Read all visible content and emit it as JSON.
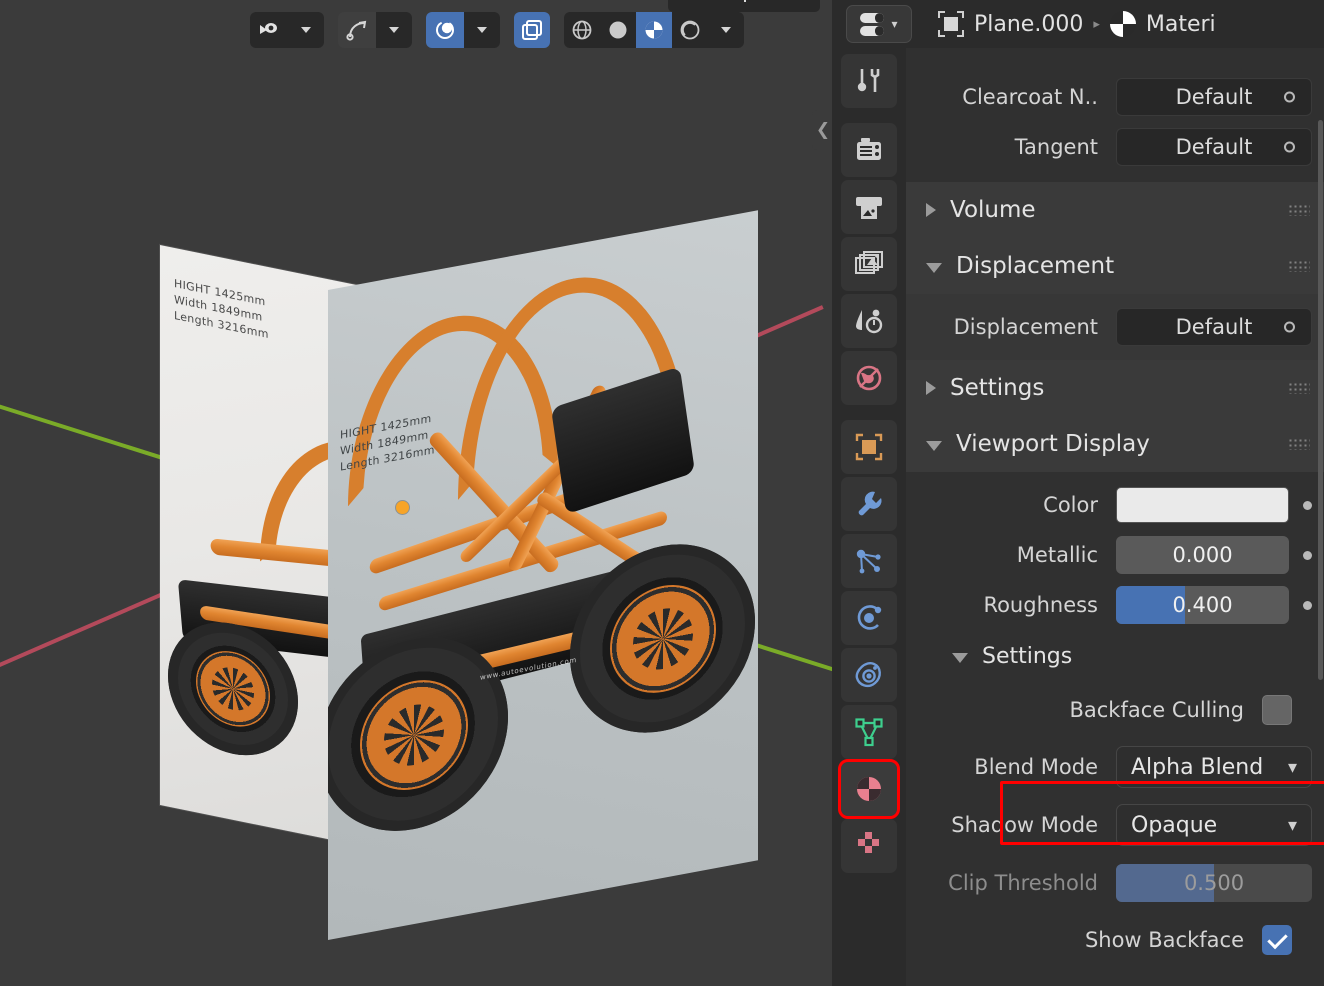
{
  "app": "Blender",
  "viewport": {
    "toolbar": {
      "groups": [
        {
          "name": "visibility",
          "buttons": [
            {
              "icon": "eye-dropdown-icon",
              "label": "",
              "state": "normal"
            },
            {
              "icon": "chevron-down-icon",
              "label": "",
              "state": "normal"
            }
          ]
        },
        {
          "name": "snap",
          "buttons": [
            {
              "icon": "snap-magnet-icon",
              "label": "",
              "state": "raised"
            },
            {
              "icon": "chevron-down-icon",
              "label": "",
              "state": "normal"
            }
          ]
        },
        {
          "name": "proportional-edit",
          "buttons": [
            {
              "icon": "proportional-edit-icon",
              "label": "",
              "state": "active"
            },
            {
              "icon": "chevron-down-icon",
              "label": "",
              "state": "normal"
            }
          ]
        },
        {
          "name": "overlays",
          "buttons": [
            {
              "icon": "overlay-icon",
              "label": "",
              "state": "active"
            }
          ]
        },
        {
          "name": "shading",
          "buttons": [
            {
              "icon": "wireframe-shading-icon",
              "label": "",
              "state": "normal"
            },
            {
              "icon": "solid-shading-icon",
              "label": "",
              "state": "normal"
            },
            {
              "icon": "material-preview-shading-icon",
              "label": "",
              "state": "active"
            },
            {
              "icon": "rendered-shading-icon",
              "label": "",
              "state": "normal"
            },
            {
              "icon": "chevron-down-icon",
              "label": "",
              "state": "normal"
            }
          ]
        }
      ]
    },
    "sidebar_toggle_icon": "chevron-left-icon",
    "reference_planes": [
      {
        "name": "back-plane",
        "dimension_lines": [
          "HIGHT 1425mm",
          "Width 1849mm",
          "Length 3216mm"
        ]
      },
      {
        "name": "front-plane",
        "dimension_lines": [
          "HIGHT 1425mm",
          "Width 1849mm",
          "Length 3216mm"
        ]
      }
    ],
    "image_watermark": "www.autoevolution.com",
    "origin_marker": "object-origin-dot",
    "axis_colors": {
      "x": "#b34a5b",
      "y": "#7aab28"
    }
  },
  "properties": {
    "header": {
      "editor_type_icon": "properties-editor-icon",
      "editor_type_chevron": "chevron-down-icon",
      "breadcrumb": [
        {
          "icon": "object-data-icon",
          "label": "Plane.000"
        },
        {
          "icon": "material-icon",
          "label": "Materi"
        }
      ],
      "separator": "▸"
    },
    "tabs": [
      {
        "name": "tool",
        "icon": "tool-icon",
        "selected": false,
        "highlighted": false
      },
      {
        "name": "render",
        "icon": "render-camera-icon",
        "selected": false,
        "highlighted": false
      },
      {
        "name": "output",
        "icon": "output-printer-icon",
        "selected": false,
        "highlighted": false
      },
      {
        "name": "view-layer",
        "icon": "view-layer-images-icon",
        "selected": false,
        "highlighted": false
      },
      {
        "name": "scene",
        "icon": "scene-cone-droplet-icon",
        "selected": false,
        "highlighted": false
      },
      {
        "name": "world",
        "icon": "world-globe-icon",
        "selected": false,
        "highlighted": false
      },
      {
        "name": "object",
        "icon": "object-square-icon",
        "selected": false,
        "highlighted": false
      },
      {
        "name": "modifiers",
        "icon": "wrench-icon",
        "selected": false,
        "highlighted": false
      },
      {
        "name": "particles",
        "icon": "particles-icon",
        "selected": false,
        "highlighted": false
      },
      {
        "name": "physics",
        "icon": "physics-orbit-icon",
        "selected": false,
        "highlighted": false
      },
      {
        "name": "constraints",
        "icon": "constraints-icon",
        "selected": false,
        "highlighted": false
      },
      {
        "name": "object-data",
        "icon": "mesh-data-triangle-icon",
        "selected": false,
        "highlighted": false
      },
      {
        "name": "material",
        "icon": "material-sphere-icon",
        "selected": true,
        "highlighted": true
      },
      {
        "name": "texture",
        "icon": "texture-checker-icon",
        "selected": false,
        "highlighted": false
      }
    ],
    "rows": {
      "clearcoat_normal": {
        "label": "Clearcoat N..",
        "value": "Default",
        "socket": "input-socket-icon"
      },
      "tangent": {
        "label": "Tangent",
        "value": "Default",
        "socket": "input-socket-icon"
      }
    },
    "panels": {
      "volume": {
        "label": "Volume",
        "open": false,
        "grip": "drag-grip-icon"
      },
      "displacement": {
        "label": "Displacement",
        "open": true,
        "grip": "drag-grip-icon",
        "row": {
          "label": "Displacement",
          "value": "Default",
          "socket": "input-socket-icon"
        }
      },
      "settings_top": {
        "label": "Settings",
        "open": false,
        "grip": "drag-grip-icon"
      },
      "viewport_display": {
        "label": "Viewport Display",
        "open": true,
        "grip": "drag-grip-icon",
        "rows": [
          {
            "label": "Color",
            "type": "color",
            "value": "#eaeaea",
            "animate_dot": true
          },
          {
            "label": "Metallic",
            "type": "slider",
            "value": "0.000",
            "fill_percent": 0,
            "animate_dot": true
          },
          {
            "label": "Roughness",
            "type": "slider",
            "value": "0.400",
            "fill_percent": 40,
            "animate_dot": true
          }
        ],
        "sub_settings": {
          "label": "Settings",
          "open": true,
          "rows": [
            {
              "label": "Backface Culling",
              "type": "checkbox",
              "checked": false
            },
            {
              "label": "Blend Mode",
              "type": "dropdown",
              "value": "Alpha Blend",
              "chevron": "chevron-down-icon",
              "highlighted": true
            },
            {
              "label": "Shadow Mode",
              "type": "dropdown",
              "value": "Opaque",
              "chevron": "chevron-down-icon",
              "highlighted": false
            },
            {
              "label": "Clip Threshold",
              "type": "slider",
              "value": "0.500",
              "fill_percent": 50,
              "disabled": true
            },
            {
              "label": "Show Backface",
              "type": "checkbox",
              "checked": true
            }
          ]
        }
      }
    },
    "highlight_color": "#ff0000"
  }
}
